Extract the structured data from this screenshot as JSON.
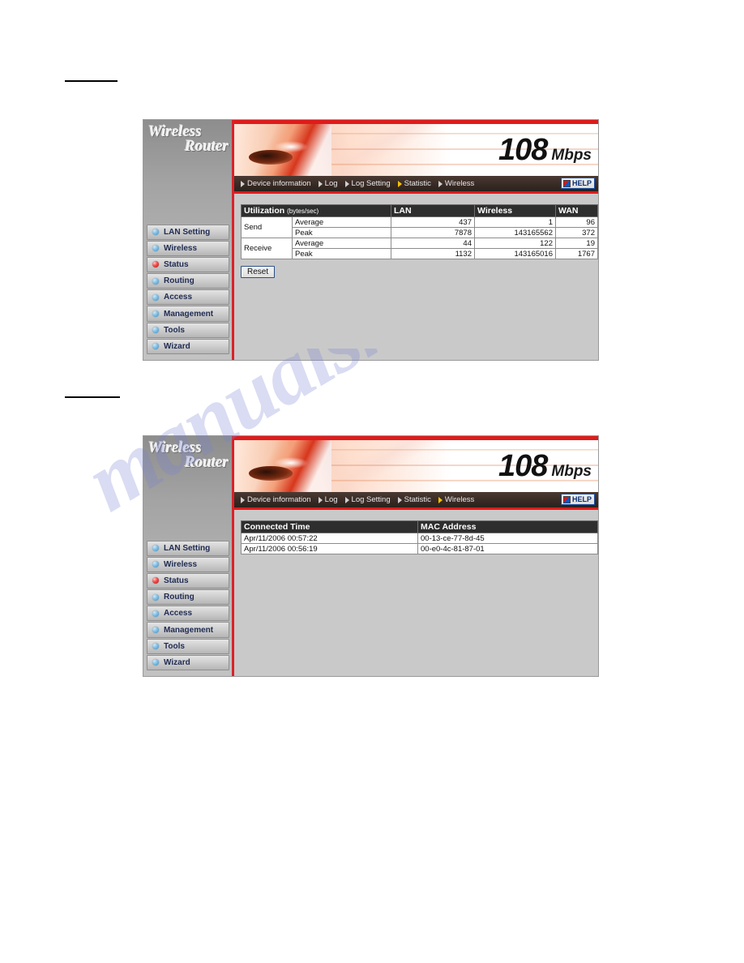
{
  "page": {
    "watermark": "manualshive.com",
    "dividers": [
      "section-rule",
      "section-rule"
    ]
  },
  "brand": {
    "logo_line1": "Wireless",
    "logo_line2": "Router",
    "speed": "108",
    "speed_unit": "Mbps"
  },
  "sidebar": {
    "items": [
      {
        "label": "LAN Setting",
        "active": false
      },
      {
        "label": "Wireless",
        "active": false
      },
      {
        "label": "Status",
        "active": true
      },
      {
        "label": "Routing",
        "active": false
      },
      {
        "label": "Access",
        "active": false
      },
      {
        "label": "Management",
        "active": false
      },
      {
        "label": "Tools",
        "active": false
      },
      {
        "label": "Wizard",
        "active": false
      }
    ]
  },
  "nav": {
    "help_label": "HELP",
    "items_panel1": [
      {
        "label": "Device information",
        "active": false
      },
      {
        "label": "Log",
        "active": false
      },
      {
        "label": "Log Setting",
        "active": false
      },
      {
        "label": "Statistic",
        "active": true
      },
      {
        "label": "Wireless",
        "active": false
      }
    ],
    "items_panel2": [
      {
        "label": "Device information",
        "active": false
      },
      {
        "label": "Log",
        "active": false
      },
      {
        "label": "Log Setting",
        "active": false
      },
      {
        "label": "Statistic",
        "active": false
      },
      {
        "label": "Wireless",
        "active": true
      }
    ]
  },
  "statistic": {
    "title": "Utilization",
    "title_unit": "(bytes/sec)",
    "columns": [
      "LAN",
      "Wireless",
      "WAN"
    ],
    "groups": [
      {
        "name": "Send",
        "rows": [
          {
            "metric": "Average",
            "lan": "437",
            "wireless": "1",
            "wan": "96"
          },
          {
            "metric": "Peak",
            "lan": "7878",
            "wireless": "143165562",
            "wan": "372"
          }
        ]
      },
      {
        "name": "Receive",
        "rows": [
          {
            "metric": "Average",
            "lan": "44",
            "wireless": "122",
            "wan": "19"
          },
          {
            "metric": "Peak",
            "lan": "1132",
            "wireless": "143165016",
            "wan": "1767"
          }
        ]
      }
    ],
    "reset_label": "Reset"
  },
  "wireless_clients": {
    "columns": [
      "Connected Time",
      "MAC Address"
    ],
    "rows": [
      {
        "time": "Apr/11/2006 00:57:22",
        "mac": "00-13-ce-77-8d-45"
      },
      {
        "time": "Apr/11/2006 00:56:19",
        "mac": "00-e0-4c-81-87-01"
      }
    ]
  },
  "colors": {
    "accent_red": "#e01b1b",
    "nav_bar": "#33251f",
    "active_arrow": "#f5c200",
    "table_header": "#2e2e2e",
    "panel_bg": "#c9c9c9",
    "watermark": "#7882d2"
  }
}
